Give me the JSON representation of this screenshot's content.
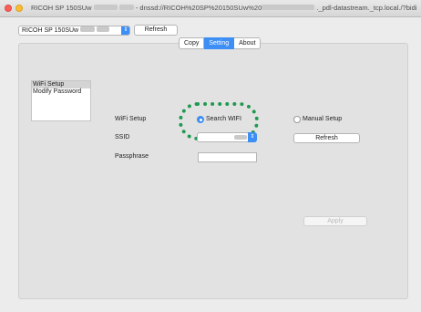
{
  "window": {
    "title_prefix": "RICOH SP 150SUw",
    "title_dnssd": "- dnssd://RICOH%20SP%20150SUw%20",
    "title_suffix": "._pdl-datastream._tcp.local./?bidi"
  },
  "toolbar": {
    "printer_select_value": "RICOH SP 150SUw",
    "refresh_label": "Refresh"
  },
  "tabs": [
    {
      "label": "Copy",
      "active": false
    },
    {
      "label": "Setting",
      "active": true
    },
    {
      "label": "About",
      "active": false
    }
  ],
  "menu": {
    "items": [
      {
        "label": "WiFi Setup",
        "selected": true
      },
      {
        "label": "Modify Password",
        "selected": false
      }
    ]
  },
  "form": {
    "wifi_setup_label": "WiFi Setup",
    "search_wifi_label": "Search WIFI",
    "manual_setup_label": "Manual Setup",
    "search_wifi_selected": true,
    "ssid_label": "SSID",
    "ssid_refresh_label": "Refresh",
    "passphrase_label": "Passphrase",
    "passphrase_value": "",
    "apply_label": "Apply"
  },
  "colors": {
    "accent": "#3d8ef5",
    "highlight_ring": "#1f9a50"
  }
}
